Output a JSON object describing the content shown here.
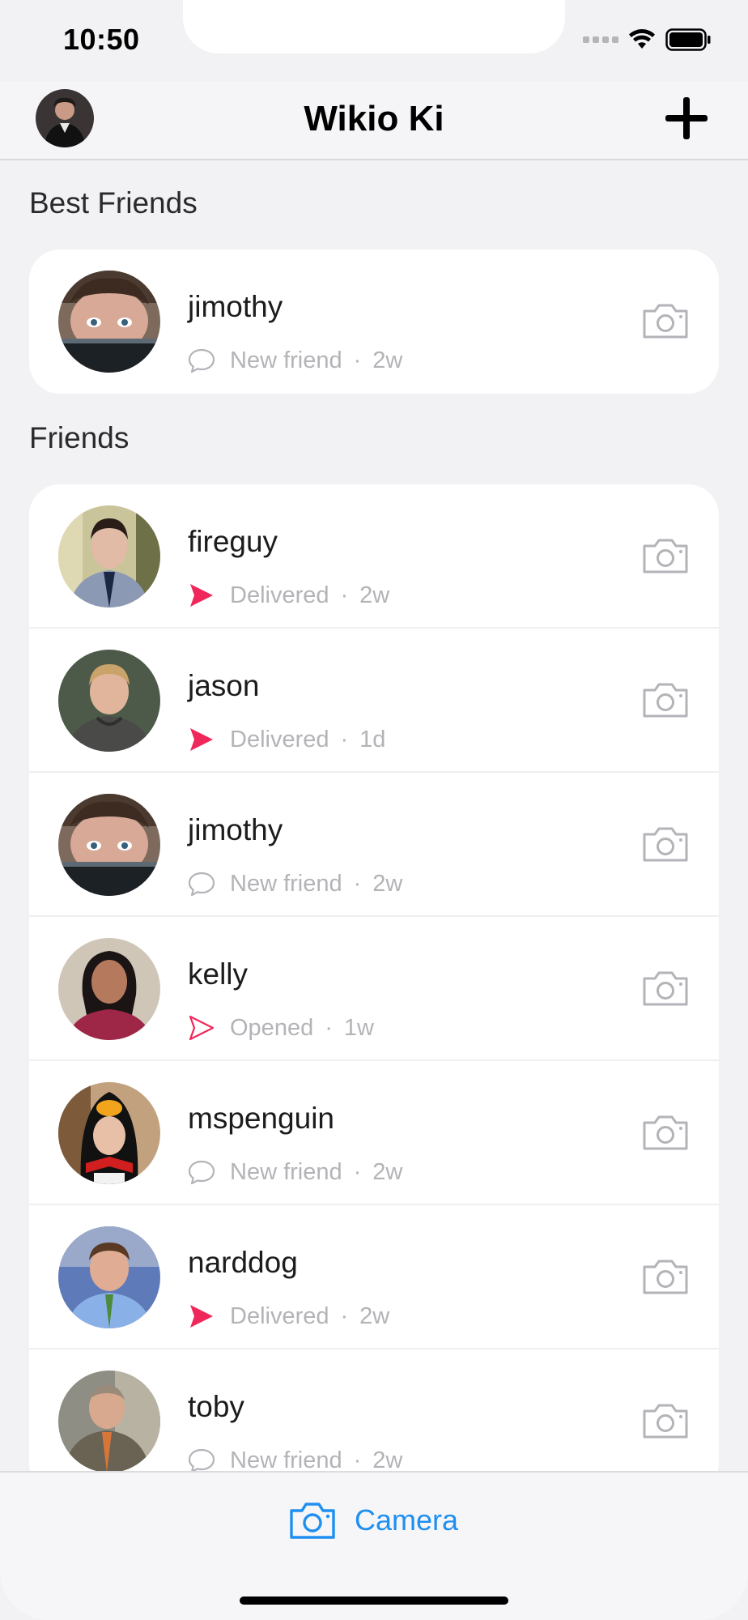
{
  "status_bar": {
    "time": "10:50"
  },
  "nav": {
    "title": "Wikio Ki",
    "avatar_icon": "profile-avatar",
    "add_icon": "plus-icon"
  },
  "sections": {
    "best_friends_title": "Best Friends",
    "friends_title": "Friends"
  },
  "best_friends": [
    {
      "name": "jimothy",
      "status": "New friend",
      "time": "2w",
      "status_icon": "chat-bubble-icon"
    }
  ],
  "friends": [
    {
      "name": "fireguy",
      "status": "Delivered",
      "time": "2w",
      "status_icon": "filled-arrow-icon"
    },
    {
      "name": "jason",
      "status": "Delivered",
      "time": "1d",
      "status_icon": "filled-arrow-icon"
    },
    {
      "name": "jimothy",
      "status": "New friend",
      "time": "2w",
      "status_icon": "chat-bubble-icon"
    },
    {
      "name": "kelly",
      "status": "Opened",
      "time": "1w",
      "status_icon": "outline-arrow-icon"
    },
    {
      "name": "mspenguin",
      "status": "New friend",
      "time": "2w",
      "status_icon": "chat-bubble-icon"
    },
    {
      "name": "narddog",
      "status": "Delivered",
      "time": "2w",
      "status_icon": "filled-arrow-icon"
    },
    {
      "name": "toby",
      "status": "New friend",
      "time": "2w",
      "status_icon": "chat-bubble-icon"
    }
  ],
  "separator": "·",
  "tab_bar": {
    "camera_label": "Camera",
    "camera_icon": "camera-icon"
  },
  "colors": {
    "accent": "#1f8ff0",
    "delivered": "#f0275a",
    "muted": "#b3b3b8"
  }
}
